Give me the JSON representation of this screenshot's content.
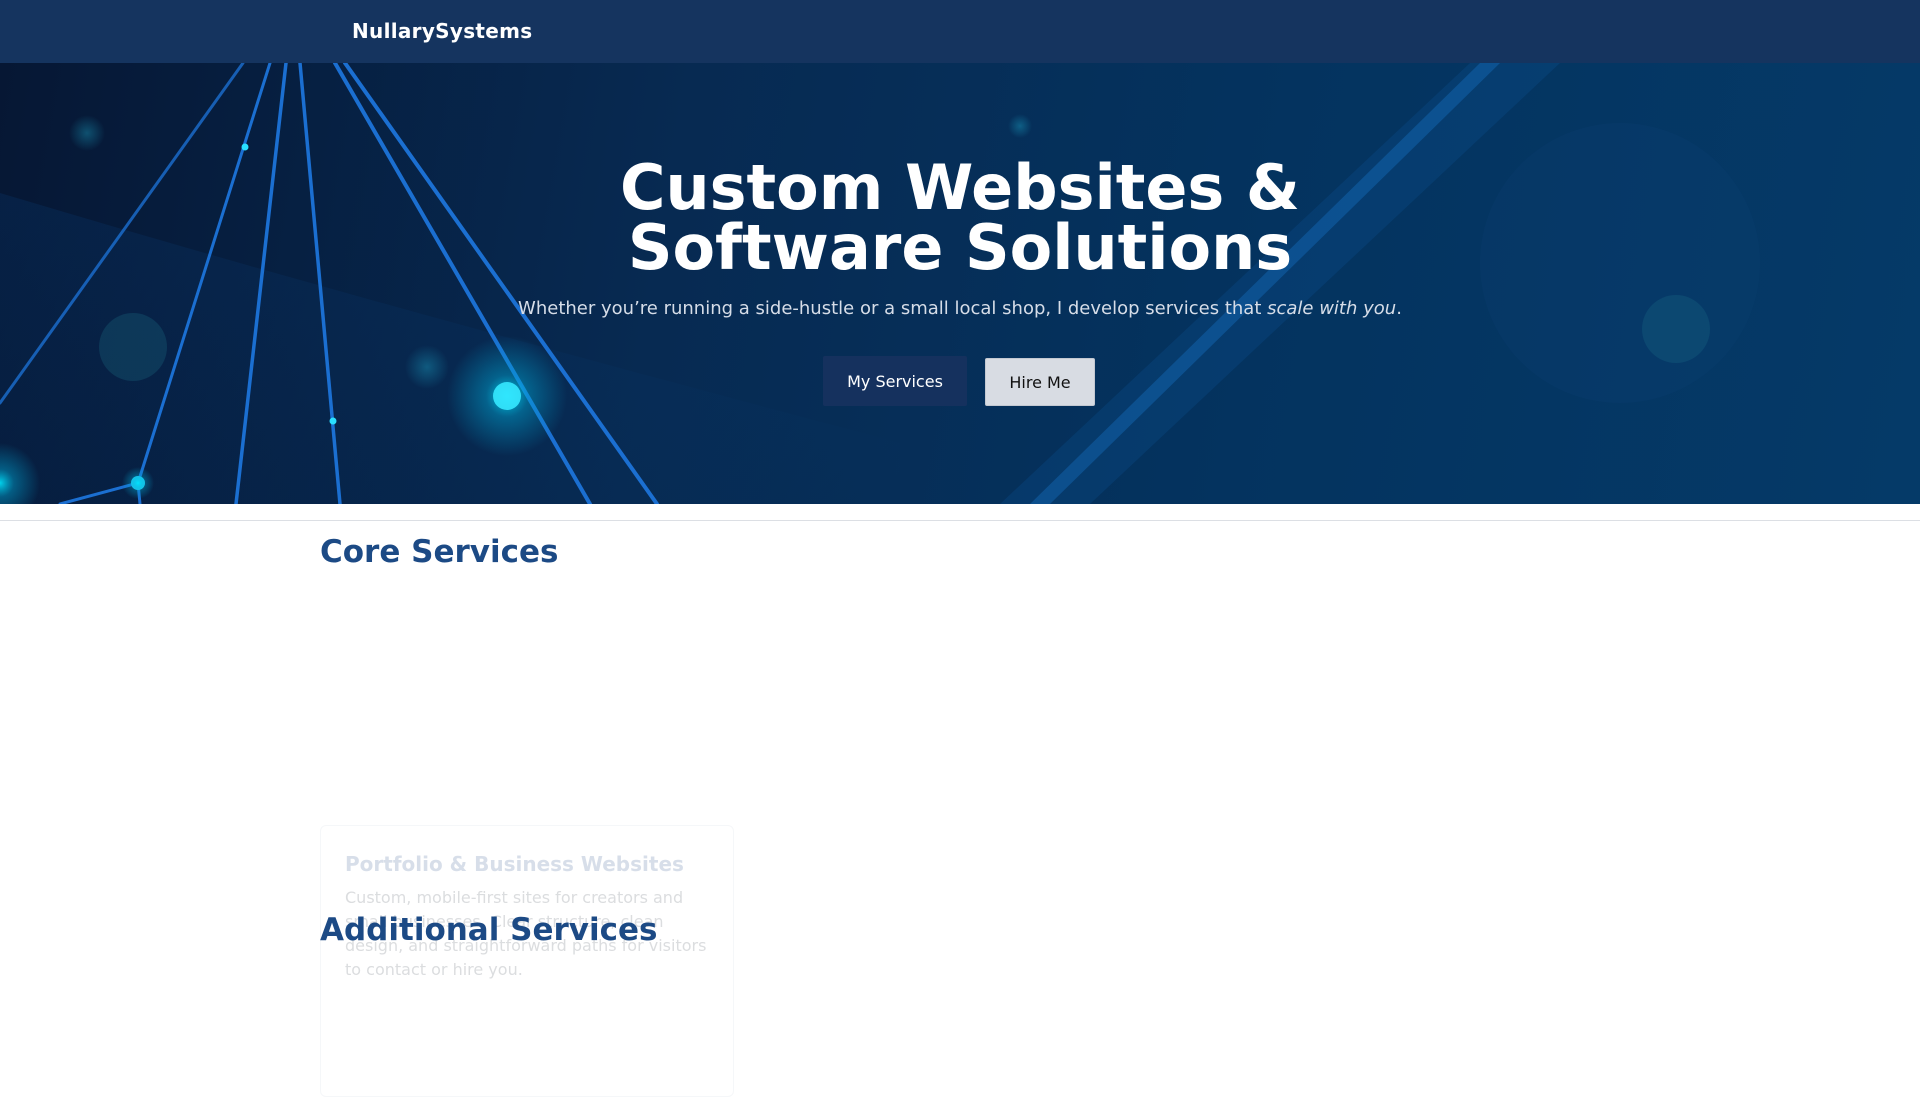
{
  "navbar": {
    "brand": "NullarySystems"
  },
  "hero": {
    "title_line1": "Custom Websites &",
    "title_line2": "Software Solutions",
    "subtitle_main": "Whether you’re running a side-hustle or a small local shop, I develop services that ",
    "subtitle_emphasis": "scale with you",
    "subtitle_end": ".",
    "primary_button": "My Services",
    "secondary_button": "Hire Me"
  },
  "sections": {
    "core_heading": "Core Services",
    "additional_heading": "Additional Services"
  },
  "cards": [
    {
      "title": "Portfolio & Business Websites",
      "description": "Custom, mobile-first sites for creators and small businesses. Clear structure, clean design, and straightforward paths for visitors to contact or hire you."
    }
  ],
  "colors": {
    "navbar": "#15345f",
    "heading": "#1c4a85",
    "accent_glow": "#00d8ff",
    "line_blue": "#1b6fd1"
  }
}
